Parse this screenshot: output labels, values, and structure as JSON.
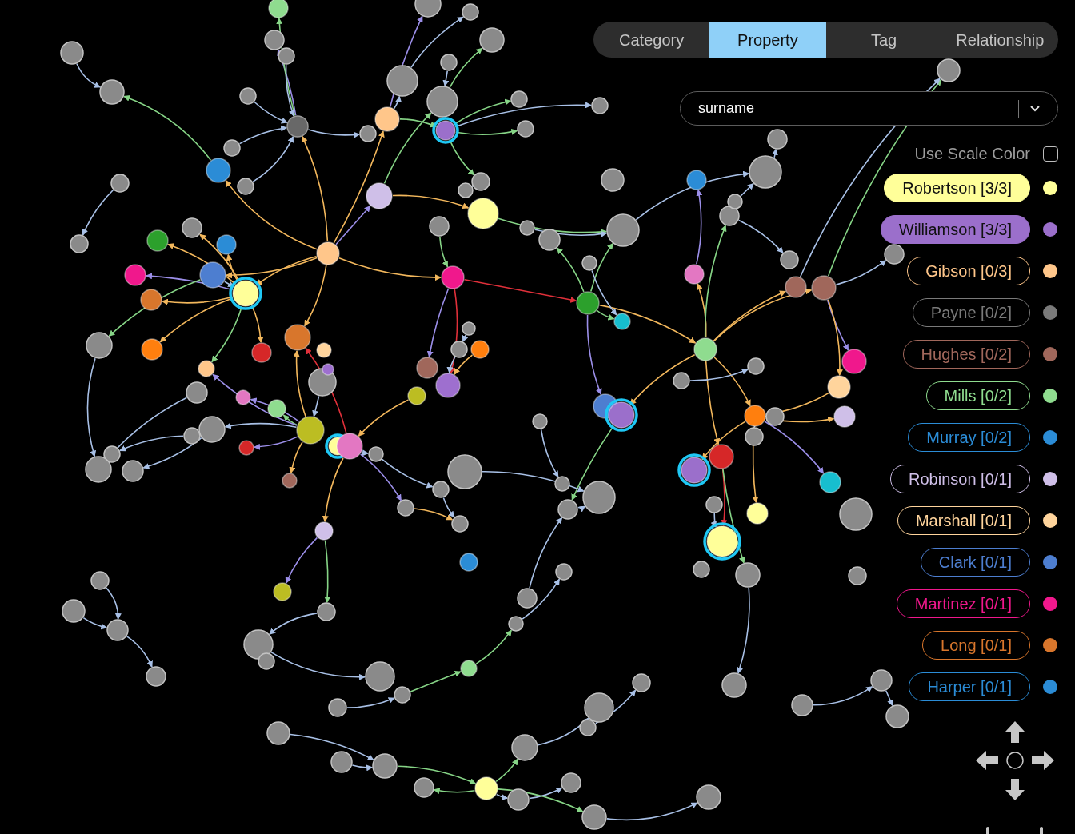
{
  "tabs": [
    {
      "label": "Category",
      "selected": false
    },
    {
      "label": "Property",
      "selected": true
    },
    {
      "label": "Tag",
      "selected": false
    },
    {
      "label": "Relationship",
      "selected": false
    }
  ],
  "property_select": {
    "value": "surname"
  },
  "scale_color": {
    "label": "Use Scale Color",
    "checked": false
  },
  "legend": [
    {
      "label": "Robertson [3/3]",
      "selected": true,
      "color": "#ffff99"
    },
    {
      "label": "Williamson [3/3]",
      "selected": true,
      "color": "#9b6fcb"
    },
    {
      "label": "Gibson [0/3]",
      "selected": false,
      "color": "#ffc68a"
    },
    {
      "label": "Payne [0/2]",
      "selected": false,
      "color": "#7a7a7a"
    },
    {
      "label": "Hughes [0/2]",
      "selected": false,
      "color": "#a0675b"
    },
    {
      "label": "Mills [0/2]",
      "selected": false,
      "color": "#8fdc8f"
    },
    {
      "label": "Murray [0/2]",
      "selected": false,
      "color": "#2b8cd6"
    },
    {
      "label": "Robinson [0/1]",
      "selected": false,
      "color": "#cfbfe8"
    },
    {
      "label": "Marshall [0/1]",
      "selected": false,
      "color": "#ffd49c"
    },
    {
      "label": "Clark [0/1]",
      "selected": false,
      "color": "#4d7ed0"
    },
    {
      "label": "Martinez [0/1]",
      "selected": false,
      "color": "#f0188c"
    },
    {
      "label": "Long [0/1]",
      "selected": false,
      "color": "#d8762c"
    },
    {
      "label": "Harper [0/1]",
      "selected": false,
      "color": "#2b8cd6"
    }
  ]
}
